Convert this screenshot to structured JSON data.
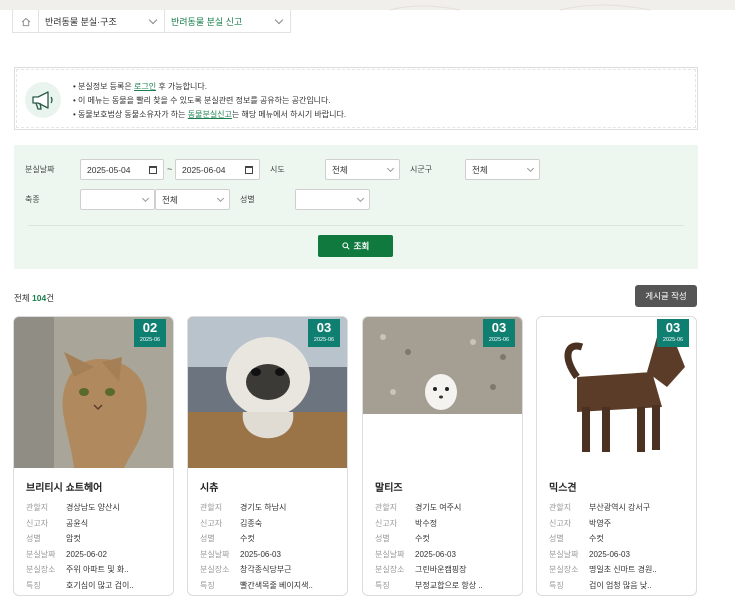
{
  "breadcrumb": {
    "item1": "반려동물 분실·구조",
    "item2": "반려동물 분실 신고"
  },
  "notice": {
    "line1_pre": "• 분실정보 등록은 ",
    "line1_link": "로그인",
    "line1_post": " 후 가능합니다.",
    "line2": "• 이 메뉴는 동물을 빨리 찾을 수 있도록 분실관련 정보를 공유하는 공간입니다.",
    "line3_pre": "• 동물보호법상 동물소유자가 하는 ",
    "line3_link": "동물분실신고",
    "line3_post": "는 해당 메뉴에서 하시기 바랍니다."
  },
  "filter": {
    "date_label": "분실날짜",
    "date_from": "2025-05-04",
    "tilde": "~",
    "date_to": "2025-06-04",
    "sido_label": "시도",
    "sido_value": "전체",
    "sigungu_label": "시군구",
    "sigungu_value": "전체",
    "species_label": "축종",
    "species_value": "",
    "breed_value": "전체",
    "sex_label": "성별",
    "sex_value": "",
    "search_label": "조회"
  },
  "list": {
    "total_pre": "전체 ",
    "total_count": "104",
    "total_post": "건",
    "write_label": "게시글 작성"
  },
  "labels": {
    "jurisdiction": "관할지",
    "reporter": "신고자",
    "sex": "성별",
    "date": "분실날짜",
    "place": "분실장소",
    "feature": "특징"
  },
  "cards": [
    {
      "day": "02",
      "month": "2025-06",
      "name": "브리티시 쇼트헤어",
      "jurisdiction": "경상남도 양산시",
      "reporter": "공윤식",
      "sex": "암컷",
      "date": "2025-06-02",
      "place": "주위 아파트 및 화..",
      "feature": "호기심이 많고 겁이.."
    },
    {
      "day": "03",
      "month": "2025-06",
      "name": "시츄",
      "jurisdiction": "경기도 하남시",
      "reporter": "김종숙",
      "sex": "수컷",
      "date": "2025-06-03",
      "place": "창각종식당부근",
      "feature": "빨간색목줄 베이지색.."
    },
    {
      "day": "03",
      "month": "2025-06",
      "name": "말티즈",
      "jurisdiction": "경기도 여주시",
      "reporter": "박수정",
      "sex": "수컷",
      "date": "2025-06-03",
      "place": "그린바운캠핑장",
      "feature": "부정교합으로 항상 .."
    },
    {
      "day": "03",
      "month": "2025-06",
      "name": "믹스견",
      "jurisdiction": "부산광역시 강서구",
      "reporter": "박영주",
      "sex": "수컷",
      "date": "2025-06-03",
      "place": "명일초 신마트 경원..",
      "feature": "겁이 엄청 많음 낮.."
    }
  ]
}
